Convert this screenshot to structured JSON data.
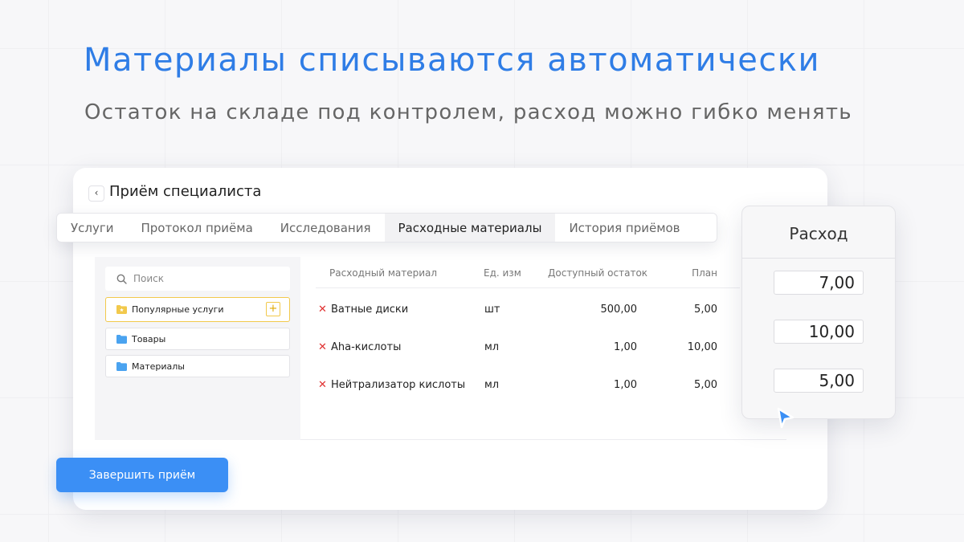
{
  "header": {
    "headline": "Материалы списываются автоматически",
    "subline": "Остаток на складе под контролем, расход можно гибко менять"
  },
  "card": {
    "back_icon": "chevron-left-icon",
    "title": "Приём специалиста"
  },
  "tabs": [
    {
      "label": "Услуги",
      "active": false
    },
    {
      "label": "Протокол приёма",
      "active": false
    },
    {
      "label": "Исследования",
      "active": false
    },
    {
      "label": "Расходные материалы",
      "active": true
    },
    {
      "label": "История приёмов",
      "active": false
    }
  ],
  "sidebar": {
    "search_placeholder": "Поиск",
    "folders": [
      {
        "label": "Популярные услуги",
        "icon": "star-folder-icon",
        "color": "#f2c94c",
        "highlighted": true
      },
      {
        "label": "Товары",
        "icon": "folder-icon",
        "color": "#4aa3f0",
        "highlighted": false
      },
      {
        "label": "Материалы",
        "icon": "folder-icon",
        "color": "#4aa3f0",
        "highlighted": false
      }
    ]
  },
  "table": {
    "columns": [
      "Расходный материал",
      "Ед. изм",
      "Доступный остаток",
      "План"
    ],
    "rows": [
      {
        "name": "Ватные диски",
        "unit": "шт",
        "available": "500,00",
        "plan": "5,00"
      },
      {
        "name": "Aha-кислоты",
        "unit": "мл",
        "available": "1,00",
        "plan": "10,00"
      },
      {
        "name": "Нейтрализатор кислоты",
        "unit": "мл",
        "available": "1,00",
        "plan": "5,00"
      }
    ]
  },
  "rashod": {
    "title": "Расход",
    "values": [
      "7,00",
      "10,00",
      "5,00"
    ]
  },
  "footer": {
    "finish_label": "Завершить приём"
  },
  "colors": {
    "accent": "#2f7de6",
    "button": "#3b8ff5",
    "remove": "#e03131",
    "highlight_border": "#f2c94c"
  }
}
